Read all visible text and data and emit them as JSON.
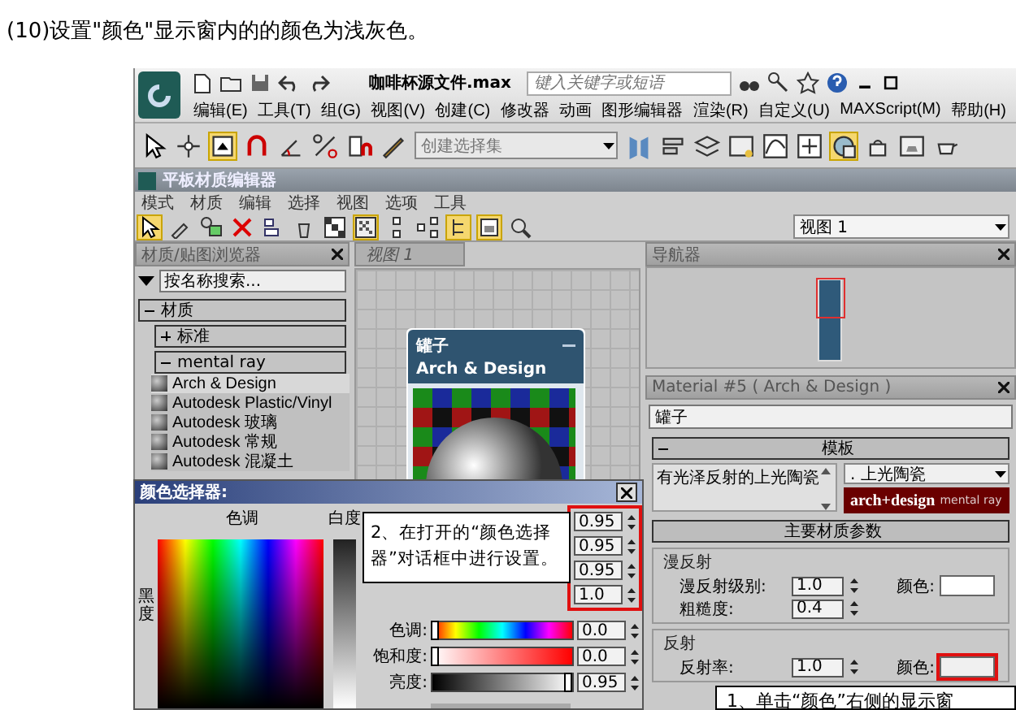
{
  "heading": "(10)设置\"颜色\"显示窗内的的颜色为浅灰色。",
  "app": {
    "title": "咖啡杯源文件.max",
    "search": {
      "placeholder": "键入关键字或短语"
    },
    "menu": [
      "编辑(E)",
      "工具(T)",
      "组(G)",
      "视图(V)",
      "创建(C)",
      "修改器",
      "动画",
      "图形编辑器",
      "渲染(R)",
      "自定义(U)",
      "MAXScript(M)",
      "帮助(H)"
    ],
    "selection_set": {
      "placeholder": "创建选择集"
    }
  },
  "editor": {
    "title": "平板材质编辑器",
    "menu": [
      "模式",
      "材质",
      "编辑",
      "选择",
      "视图",
      "选项",
      "工具"
    ],
    "view_select": "视图 1",
    "browser": {
      "title": "材质/贴图浏览器",
      "search": {
        "value": "按名称搜索..."
      },
      "tree": [
        {
          "label": "材质",
          "expanded": true,
          "children": [
            {
              "label": "标准",
              "expanded": false
            },
            {
              "label": "mental ray",
              "expanded": true,
              "children": [
                {
                  "label": "Arch & Design",
                  "selected": true
                },
                {
                  "label": "Autodesk Plastic/Vinyl",
                  "selected": false
                },
                {
                  "label": "Autodesk 玻璃",
                  "selected": false
                },
                {
                  "label": "Autodesk 常规",
                  "selected": false
                },
                {
                  "label": "Autodesk 混凝土",
                  "selected": false
                }
              ]
            }
          ]
        }
      ]
    },
    "view_tab": "视图 1",
    "node": {
      "title": "罐子",
      "subtitle": "Arch & Design"
    },
    "navigator": {
      "title": "导航器"
    },
    "material": {
      "title": "Material #5 ( Arch & Design )",
      "name": "罐子",
      "template": {
        "title": "模板",
        "list_item": "有光泽反射的上光陶瓷",
        "dropdown": ". 上光陶瓷",
        "banner": "arch+design",
        "banner_brand": "mental ray"
      },
      "main_params": "主要材质参数",
      "groups": [
        {
          "title": "漫反射",
          "rows": [
            {
              "label": "漫反射级别:",
              "value": "1.0",
              "color_label": "颜色:",
              "highlighted": false
            },
            {
              "label": "粗糙度:",
              "value": "0.4"
            }
          ]
        },
        {
          "title": "反射",
          "rows": [
            {
              "label": "反射率:",
              "value": "1.0",
              "color_label": "颜色:",
              "highlighted": true
            }
          ]
        }
      ]
    }
  },
  "color_dialog": {
    "title": "颜色选择器:",
    "hue_label": "色调",
    "whiteness_label": "白度",
    "blackness_label": "黑度",
    "values": [
      "0.95",
      "0.95",
      "0.95",
      "1.0"
    ],
    "sliders": [
      {
        "kind": "hue",
        "label": "色调:",
        "level": 0,
        "value": "0.0"
      },
      {
        "kind": "saturation",
        "label": "饱和度:",
        "level": 0,
        "value": "0.0"
      },
      {
        "kind": "brightness",
        "label": "亮度:",
        "level": 0.95,
        "value": "0.95"
      }
    ]
  },
  "callouts": [
    {
      "text": "2、在打开的“颜色选择器”对话框中进行设置。"
    },
    {
      "text": "1、单击“颜色”右侧的显示窗"
    }
  ]
}
